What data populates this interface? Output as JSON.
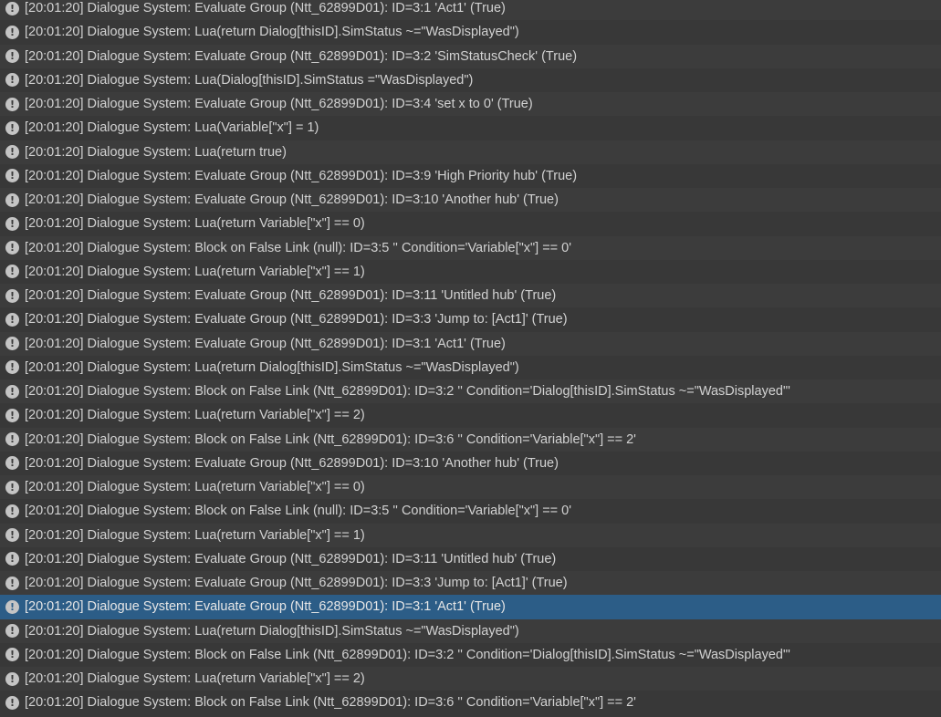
{
  "console": {
    "icon_name": "info-icon",
    "icon_glyph": "!",
    "selected_index": 25,
    "rows": [
      "[20:01:20] Dialogue System: Evaluate Group (Ntt_62899D01): ID=3:1 'Act1' (True)",
      "[20:01:20] Dialogue System: Lua(return Dialog[thisID].SimStatus ~=\"WasDisplayed\")",
      "[20:01:20] Dialogue System: Evaluate Group (Ntt_62899D01): ID=3:2 'SimStatusCheck' (True)",
      "[20:01:20] Dialogue System: Lua(Dialog[thisID].SimStatus =\"WasDisplayed\")",
      "[20:01:20] Dialogue System: Evaluate Group (Ntt_62899D01): ID=3:4 'set x to 0' (True)",
      "[20:01:20] Dialogue System: Lua(Variable[\"x\"] = 1)",
      "[20:01:20] Dialogue System: Lua(return true)",
      "[20:01:20] Dialogue System: Evaluate Group (Ntt_62899D01): ID=3:9 'High Priority hub' (True)",
      "[20:01:20] Dialogue System: Evaluate Group (Ntt_62899D01): ID=3:10 'Another hub' (True)",
      "[20:01:20] Dialogue System: Lua(return Variable[\"x\"] == 0)",
      "[20:01:20] Dialogue System: Block on False Link (null): ID=3:5 '' Condition='Variable[\"x\"] == 0'",
      "[20:01:20] Dialogue System: Lua(return Variable[\"x\"] == 1)",
      "[20:01:20] Dialogue System: Evaluate Group (Ntt_62899D01): ID=3:11 'Untitled hub' (True)",
      "[20:01:20] Dialogue System: Evaluate Group (Ntt_62899D01): ID=3:3 'Jump to: [Act1]' (True)",
      "[20:01:20] Dialogue System: Evaluate Group (Ntt_62899D01): ID=3:1 'Act1' (True)",
      "[20:01:20] Dialogue System: Lua(return Dialog[thisID].SimStatus ~=\"WasDisplayed\")",
      "[20:01:20] Dialogue System: Block on False Link (Ntt_62899D01): ID=3:2 '' Condition='Dialog[thisID].SimStatus ~=\"WasDisplayed\"'",
      "[20:01:20] Dialogue System: Lua(return Variable[\"x\"] == 2)",
      "[20:01:20] Dialogue System: Block on False Link (Ntt_62899D01): ID=3:6 '' Condition='Variable[\"x\"] == 2'",
      "[20:01:20] Dialogue System: Evaluate Group (Ntt_62899D01): ID=3:10 'Another hub' (True)",
      "[20:01:20] Dialogue System: Lua(return Variable[\"x\"] == 0)",
      "[20:01:20] Dialogue System: Block on False Link (null): ID=3:5 '' Condition='Variable[\"x\"] == 0'",
      "[20:01:20] Dialogue System: Lua(return Variable[\"x\"] == 1)",
      "[20:01:20] Dialogue System: Evaluate Group (Ntt_62899D01): ID=3:11 'Untitled hub' (True)",
      "[20:01:20] Dialogue System: Evaluate Group (Ntt_62899D01): ID=3:3 'Jump to: [Act1]' (True)",
      "[20:01:20] Dialogue System: Evaluate Group (Ntt_62899D01): ID=3:1 'Act1' (True)",
      "[20:01:20] Dialogue System: Lua(return Dialog[thisID].SimStatus ~=\"WasDisplayed\")",
      "[20:01:20] Dialogue System: Block on False Link (Ntt_62899D01): ID=3:2 '' Condition='Dialog[thisID].SimStatus ~=\"WasDisplayed\"'",
      "[20:01:20] Dialogue System: Lua(return Variable[\"x\"] == 2)",
      "[20:01:20] Dialogue System: Block on False Link (Ntt_62899D01): ID=3:6 '' Condition='Variable[\"x\"] == 2'"
    ]
  }
}
